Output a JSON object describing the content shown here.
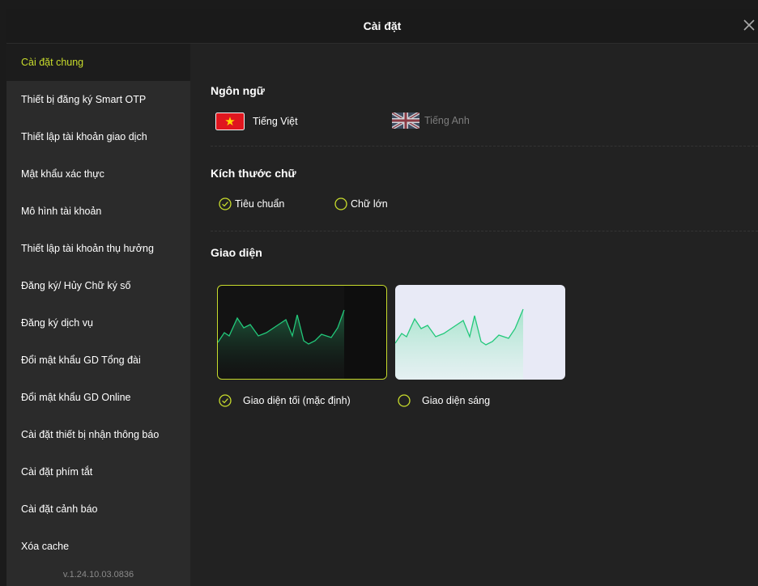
{
  "dialog": {
    "title": "Cài đặt",
    "close_icon": "close-icon"
  },
  "sidebar": {
    "items": [
      {
        "label": "Cài đặt chung",
        "active": true
      },
      {
        "label": "Thiết bị đăng ký Smart OTP"
      },
      {
        "label": "Thiết lập tài khoản giao dịch"
      },
      {
        "label": "Mật khẩu xác thực"
      },
      {
        "label": "Mô hình tài khoản"
      },
      {
        "label": "Thiết lập tài khoản thụ hưởng"
      },
      {
        "label": "Đăng ký/ Hủy Chữ ký số"
      },
      {
        "label": "Đăng ký dịch vụ"
      },
      {
        "label": "Đổi mật khẩu GD Tổng đài"
      },
      {
        "label": "Đổi mật khẩu GD Online"
      },
      {
        "label": "Cài đặt thiết bị nhận thông báo"
      },
      {
        "label": "Cài đặt phím tắt"
      },
      {
        "label": "Cài đặt cảnh báo"
      },
      {
        "label": "Xóa cache"
      }
    ],
    "version": "v.1.24.10.03.0836"
  },
  "language": {
    "title": "Ngôn ngữ",
    "options": [
      {
        "label": "Tiếng Việt",
        "icon": "vietnam-flag-icon",
        "selected": true
      },
      {
        "label": "Tiếng Anh",
        "icon": "uk-flag-icon",
        "selected": false
      }
    ]
  },
  "font_size": {
    "title": "Kích thước chữ",
    "options": [
      {
        "label": "Tiêu chuẩn",
        "selected": true
      },
      {
        "label": "Chữ lớn",
        "selected": false
      }
    ]
  },
  "theme": {
    "title": "Giao diện",
    "options": [
      {
        "label": "Giao diện tối (mặc định)",
        "selected": true
      },
      {
        "label": "Giao diện sáng",
        "selected": false
      }
    ]
  },
  "colors": {
    "accent": "#c8dc2c",
    "chart_line": "#22c87a",
    "dark_card_bg": "#131313",
    "light_card_bg": "#e8eaf6"
  }
}
